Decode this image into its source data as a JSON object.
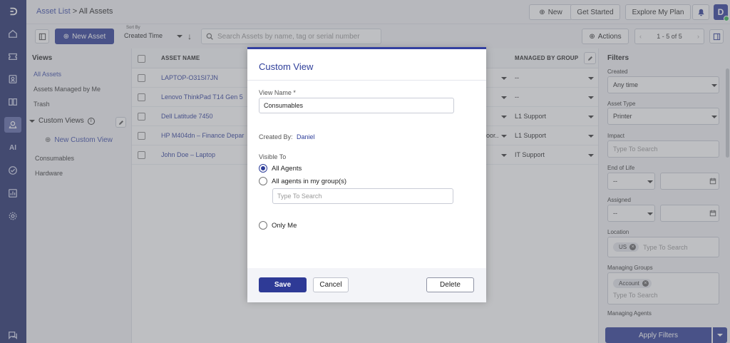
{
  "nav_rail": {
    "icons": [
      "logo-icon",
      "home-icon",
      "ticket-icon",
      "contacts-icon",
      "book-icon",
      "assets-icon",
      "ai-icon",
      "check-circle-icon",
      "report-icon",
      "settings-icon",
      "chat-icon"
    ],
    "ai_label": "AI"
  },
  "topbar": {
    "breadcrumb_link": "Asset List",
    "breadcrumb_sep": ">",
    "breadcrumb_current": "All Assets",
    "new_label": "New",
    "get_started_label": "Get Started",
    "explore_label": "Explore My Plan",
    "avatar_letter": "D"
  },
  "toolbar": {
    "new_asset_label": "New Asset",
    "sort_by_label": "Sort By",
    "sort_value": "Created Time",
    "search_placeholder": "Search Assets by name, tag or serial number",
    "actions_label": "Actions",
    "page_range": "1 - 5 of 5"
  },
  "views": {
    "header": "Views",
    "items": [
      "All Assets",
      "Assets Managed by Me",
      "Trash"
    ],
    "custom_views_label": "Custom Views",
    "new_custom_view_label": "New Custom View",
    "custom_items": [
      "Consumables",
      "Hardware"
    ]
  },
  "table": {
    "columns": [
      "ASSET NAME",
      "MANAGED BY GROUP"
    ],
    "rows": [
      {
        "name": "LAPTOP-O31SI7JN",
        "location": "",
        "managed_by_group": "--"
      },
      {
        "name": "Lenovo ThinkPad T14 Gen 5",
        "location": "",
        "managed_by_group": "--"
      },
      {
        "name": "Dell Latitude 7450",
        "location": "",
        "managed_by_group": "L1 Support"
      },
      {
        "name": "HP M404dn – Finance Depar",
        "location": "oor..",
        "managed_by_group": "L1 Support"
      },
      {
        "name": "John Doe – Laptop",
        "location": "",
        "managed_by_group": "IT Support"
      }
    ]
  },
  "filters": {
    "header": "Filters",
    "created_label": "Created",
    "created_value": "Any time",
    "asset_type_label": "Asset Type",
    "asset_type_value": "Printer",
    "impact_label": "Impact",
    "impact_placeholder": "Type To Search",
    "end_of_life_label": "End of Life",
    "end_of_life_value": "--",
    "assigned_label": "Assigned",
    "assigned_value": "--",
    "location_label": "Location",
    "location_chip": "US",
    "location_placeholder": "Type To Search",
    "managing_groups_label": "Managing Groups",
    "managing_groups_chip": "Account",
    "managing_groups_placeholder": "Type To Search",
    "managing_agents_label": "Managing Agents",
    "apply_label": "Apply Filters"
  },
  "modal": {
    "title": "Custom View",
    "view_name_label": "View Name *",
    "view_name_value": "Consumables",
    "created_by_label": "Created By:",
    "created_by_value": "Daniel",
    "visible_to_label": "Visible To",
    "options": [
      "All Agents",
      "All agents in my group(s)",
      "Only Me"
    ],
    "selected_option": "All Agents",
    "group_search_placeholder": "Type To Search",
    "save_label": "Save",
    "cancel_label": "Cancel",
    "delete_label": "Delete"
  },
  "colors": {
    "rail": "#1f2b6b",
    "primary": "#2b3a96",
    "link": "#3a4aa8"
  }
}
